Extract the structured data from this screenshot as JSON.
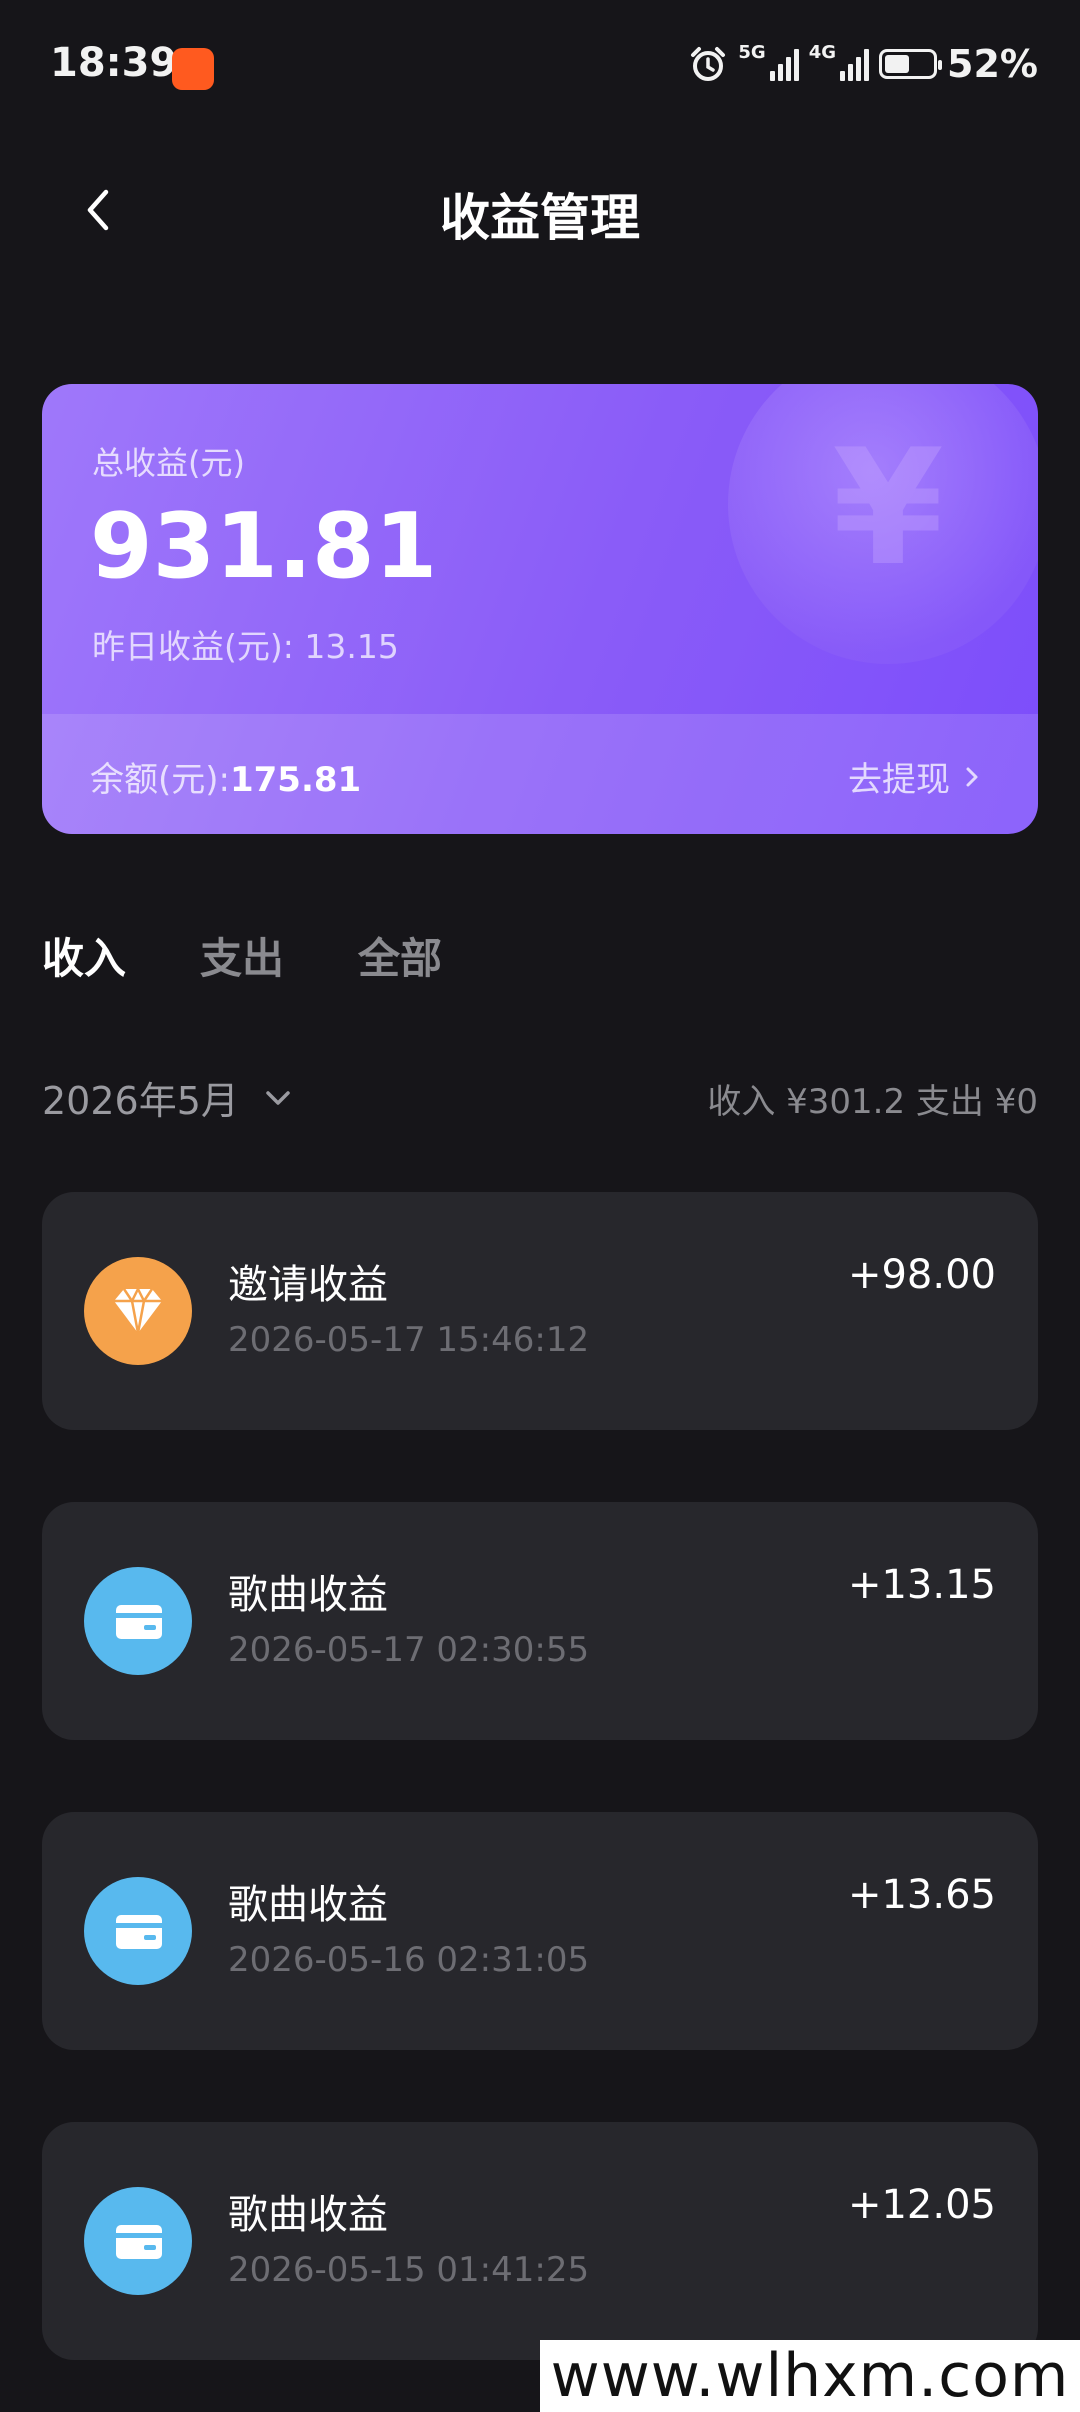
{
  "status_bar": {
    "time": "18:39",
    "network_1": "5G",
    "network_2": "4G",
    "battery_level": 0.52,
    "battery_text": "52%"
  },
  "header": {
    "title": "收益管理"
  },
  "summary": {
    "total_label": "总收益(元)",
    "total_value": "931.81",
    "yesterday_text": "昨日收益(元): 13.15",
    "balance_label": "余额(元):",
    "balance_value": "175.81",
    "withdraw_label": "去提现"
  },
  "tabs": [
    {
      "label": "收入",
      "active": true
    },
    {
      "label": "支出",
      "active": false
    },
    {
      "label": "全部",
      "active": false
    }
  ],
  "filter": {
    "month": "2026年5月",
    "summary": "收入 ¥301.2 支出 ¥0"
  },
  "records": [
    {
      "title": "邀请收益",
      "time": "2026-05-17 15:46:12",
      "amount": "+98.00",
      "icon": "diamond-icon",
      "icon_color": "#f5a24b"
    },
    {
      "title": "歌曲收益",
      "time": "2026-05-17 02:30:55",
      "amount": "+13.15",
      "icon": "wallet-icon",
      "icon_color": "#58b9ee"
    },
    {
      "title": "歌曲收益",
      "time": "2026-05-16 02:31:05",
      "amount": "+13.65",
      "icon": "wallet-icon",
      "icon_color": "#58b9ee"
    },
    {
      "title": "歌曲收益",
      "time": "2026-05-15 01:41:25",
      "amount": "+12.05",
      "icon": "wallet-icon",
      "icon_color": "#58b9ee"
    }
  ],
  "watermark": "www.wlhxm.com",
  "colors": {
    "background": "#161519",
    "card_start": "#9f78fa",
    "card_end": "#7c4dfb",
    "list_item_bg": "#27272c"
  }
}
